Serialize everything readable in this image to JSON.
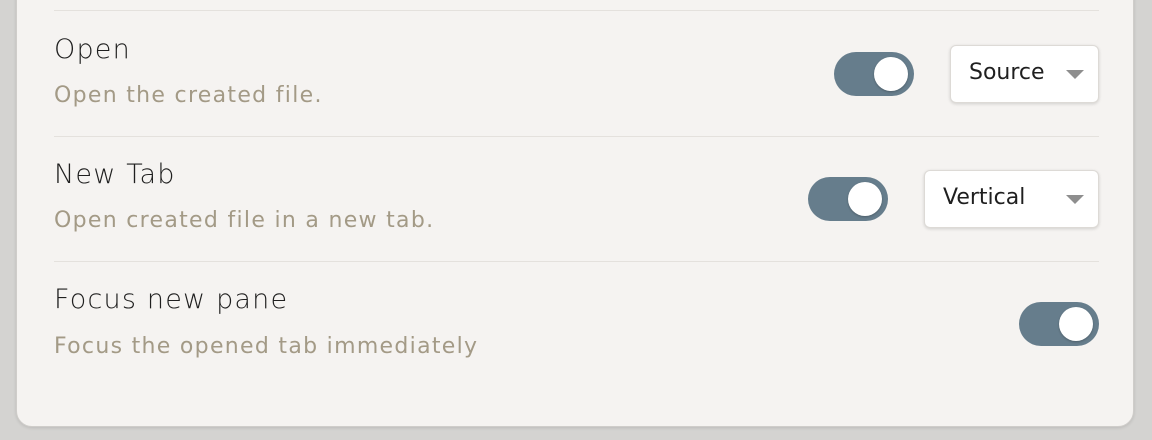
{
  "settings": [
    {
      "name": "Open",
      "description": "Open the created file.",
      "toggle_on": true,
      "dropdown_value": "Source"
    },
    {
      "name": "New Tab",
      "description": "Open created file in a new tab.",
      "toggle_on": true,
      "dropdown_value": "Vertical"
    },
    {
      "name": "Focus new pane",
      "description": "Focus the opened tab immediately",
      "toggle_on": true
    }
  ],
  "colors": {
    "panel_background": "#f5f3f1",
    "toggle_active": "#667d8c",
    "description_text": "#a39a86",
    "name_text": "#1f1f1f"
  },
  "icons": {
    "dropdown_caret": "chevron-down-icon",
    "toggle_knob": "toggle-knob"
  }
}
